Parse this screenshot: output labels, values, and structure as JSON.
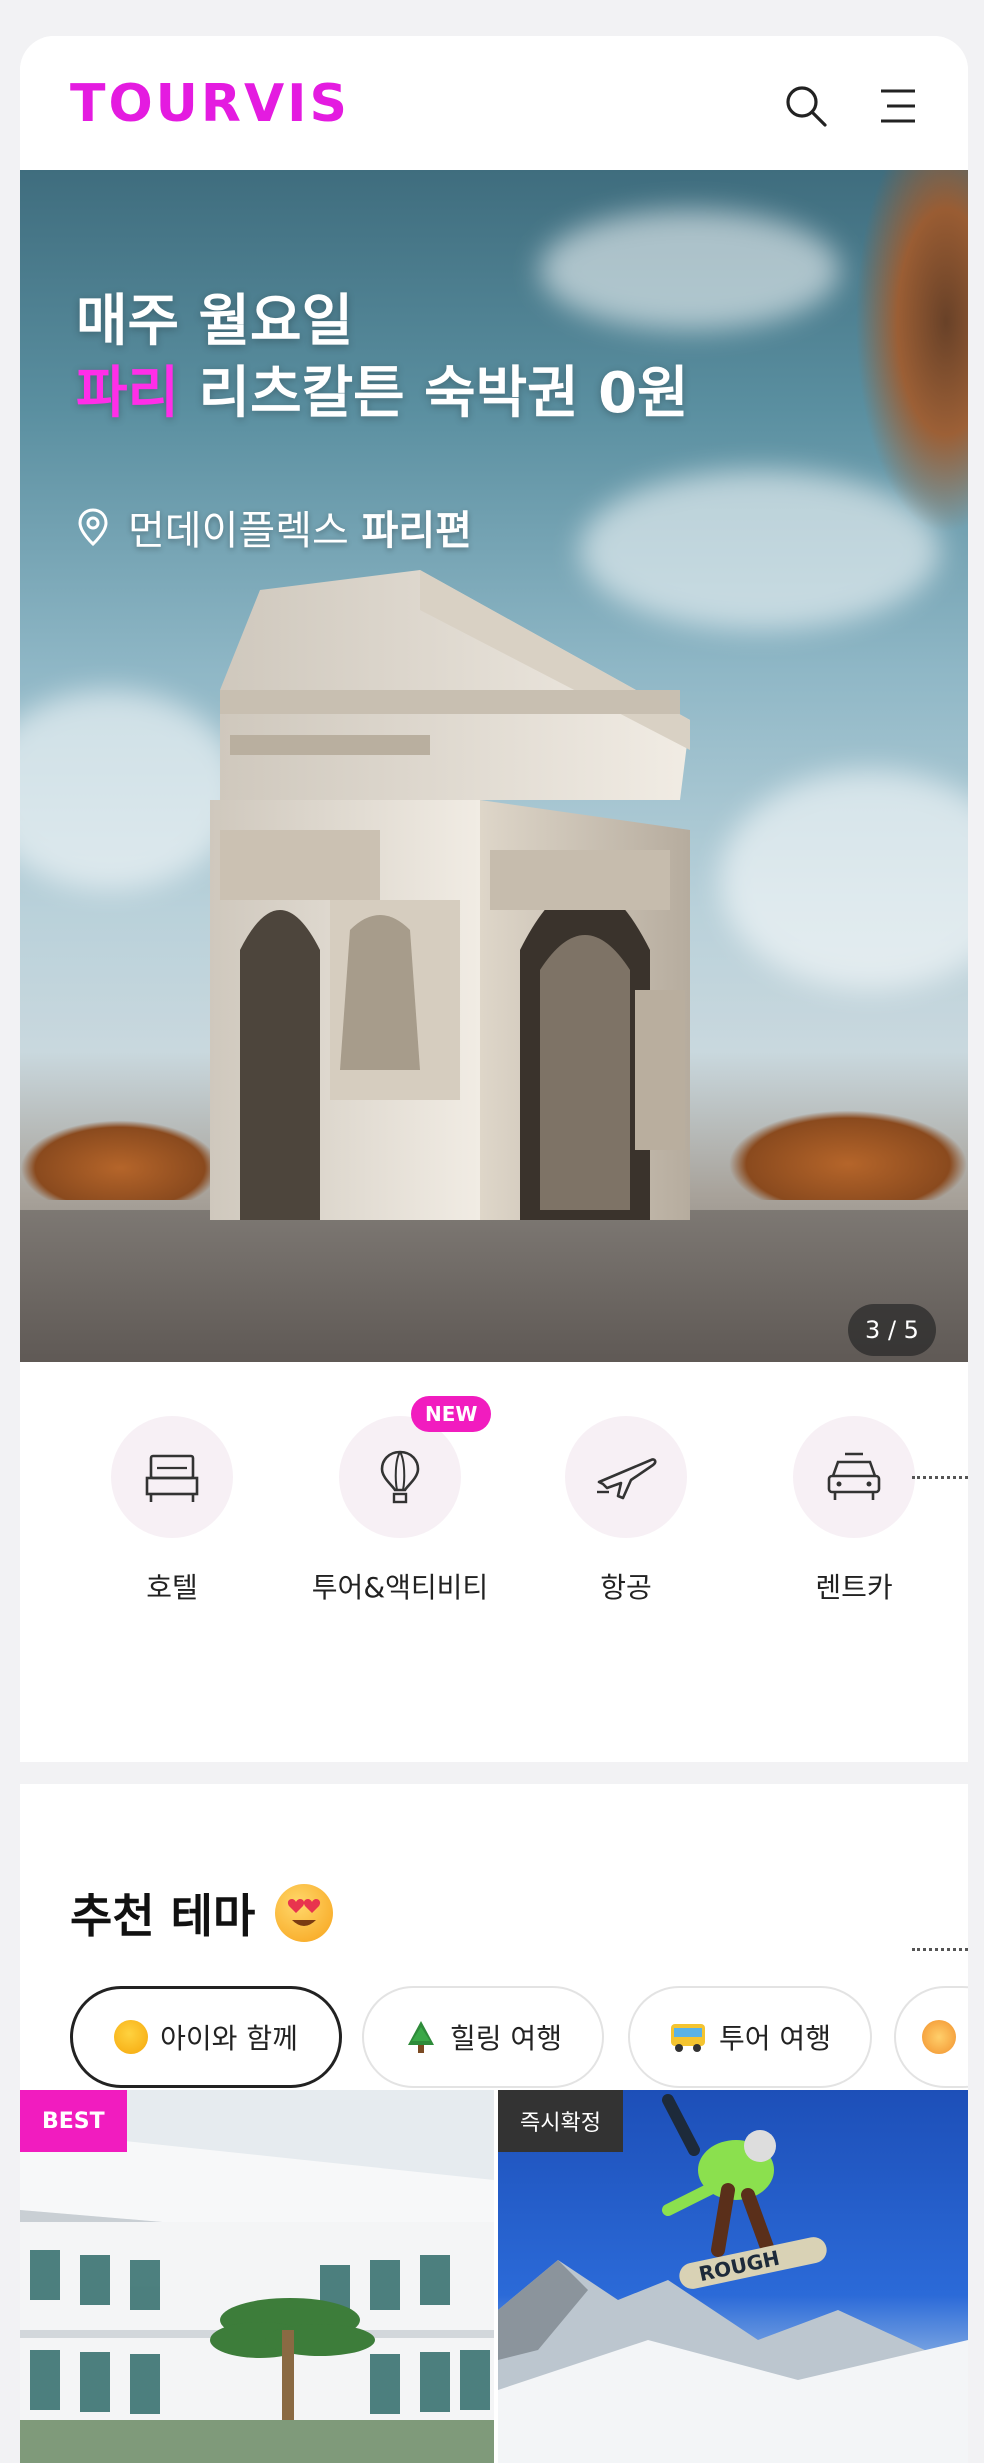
{
  "header": {
    "logo_text": "TOURVIS",
    "search_icon": "search-icon",
    "menu_icon": "menu-icon",
    "brand_color": "#e41be0"
  },
  "hero": {
    "title_line1": "매주 월요일",
    "title_highlight": "파리",
    "title_line2_rest": " 리츠칼튼 숙박권 0원",
    "location_prefix": "먼데이플렉스 ",
    "location_bold": "파리편",
    "pager": "3 / 5",
    "highlight_color": "#ff2ee8"
  },
  "categories": [
    {
      "label": "호텔",
      "icon": "bed-icon"
    },
    {
      "label": "투어&액티비티",
      "icon": "balloon-icon",
      "badge": "NEW"
    },
    {
      "label": "항공",
      "icon": "airplane-icon"
    },
    {
      "label": "렌트카",
      "icon": "car-icon"
    }
  ],
  "theme": {
    "title": "추천 테마",
    "title_icon": "heart-eyes-emoji-icon",
    "chips": [
      {
        "label": "아이와 함께",
        "icon": "chick-icon",
        "active": true
      },
      {
        "label": "힐링 여행",
        "icon": "tree-icon",
        "active": false
      },
      {
        "label": "투어 여행",
        "icon": "bus-icon",
        "active": false
      }
    ]
  },
  "products": [
    {
      "tag": "BEST",
      "image": "hotel-image"
    },
    {
      "tag": "즉시확정",
      "image": "snowboard-image"
    }
  ]
}
